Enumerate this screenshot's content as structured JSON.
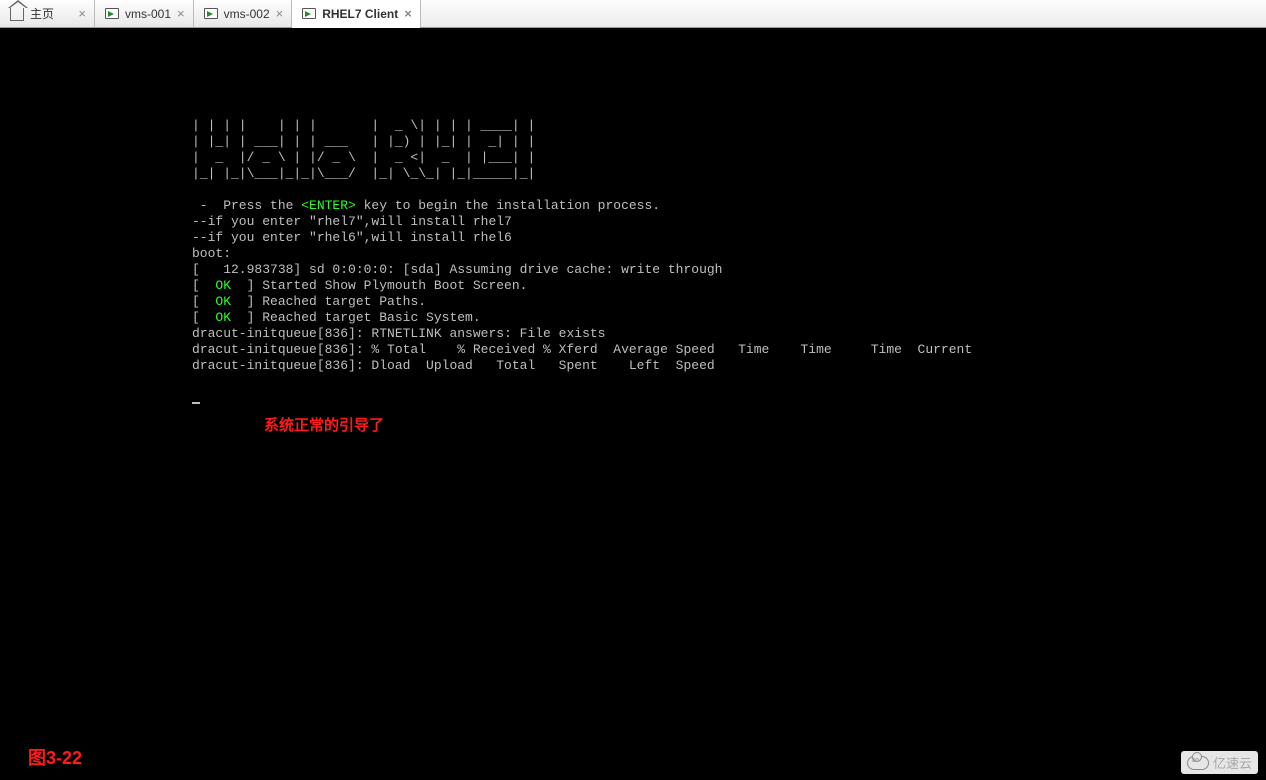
{
  "tabs": [
    {
      "label": "主页",
      "type": "home"
    },
    {
      "label": "vms-001",
      "type": "vm"
    },
    {
      "label": "vms-002",
      "type": "vm"
    },
    {
      "label": "RHEL7 Client",
      "type": "vm",
      "active": true
    }
  ],
  "ascii_art": [
    "| | | |    | | |       |  _ \\| | | | ____| |",
    "| |_| | ___| | | ___   | |_) | |_| |  _| | |",
    "|  _  |/ _ \\ | |/ _ \\  |  _ <|  _  | |___| |",
    "|_| |_|\\___|_|_|\\___/  |_| \\_\\_| |_|_____|_|"
  ],
  "press_prefix": " -  Press the ",
  "enter_key": "<ENTER>",
  "press_suffix": " key to begin the installation process.",
  "line_if7": "--if you enter \"rhel7\",will install rhel7",
  "line_if6": "--if you enter \"rhel6\",will install rhel6",
  "boot": "boot:",
  "sd_line": "[   12.983738] sd 0:0:0:0: [sda] Assuming drive cache: write through",
  "ok_lines": [
    {
      "pre": "[  ",
      "ok": "OK",
      "post": "  ] Started Show Plymouth Boot Screen."
    },
    {
      "pre": "[  ",
      "ok": "OK",
      "post": "  ] Reached target Paths."
    },
    {
      "pre": "[  ",
      "ok": "OK",
      "post": "  ] Reached target Basic System."
    }
  ],
  "dracut1": "dracut-initqueue[836]: RTNETLINK answers: File exists",
  "dracut2": "dracut-initqueue[836]: % Total    % Received % Xferd  Average Speed   Time    Time     Time  Current",
  "dracut3": "dracut-initqueue[836]: Dload  Upload   Total   Spent    Left  Speed",
  "annotation_msg": "系统正常的引导了",
  "figure_caption": "图3-22",
  "watermark": "亿速云"
}
